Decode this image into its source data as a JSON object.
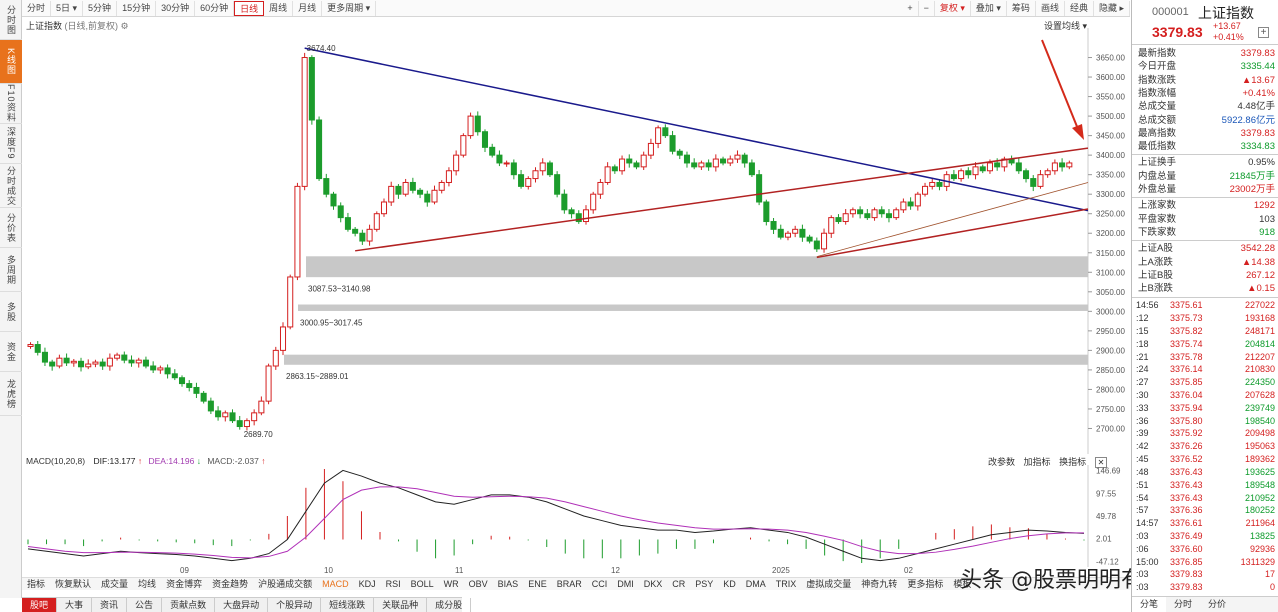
{
  "left_nav": [
    {
      "label": "分时图",
      "active": false
    },
    {
      "label": "K线图",
      "active": true
    },
    {
      "label": "F10资料",
      "active": false
    },
    {
      "label": "深度F9",
      "active": false
    },
    {
      "label": "分时成交",
      "active": false
    },
    {
      "label": "分价表",
      "active": false
    },
    {
      "label": "多周期",
      "active": false
    },
    {
      "label": "多股",
      "active": false
    },
    {
      "label": "资金",
      "active": false
    },
    {
      "label": "龙虎榜",
      "active": false
    }
  ],
  "toolbar": {
    "periods": [
      {
        "label": "分时",
        "active": false
      },
      {
        "label": "5日 ▾",
        "active": false
      },
      {
        "label": "5分钟",
        "active": false
      },
      {
        "label": "15分钟",
        "active": false
      },
      {
        "label": "30分钟",
        "active": false
      },
      {
        "label": "60分钟",
        "active": false
      },
      {
        "label": "日线",
        "active": true
      },
      {
        "label": "周线",
        "active": false
      },
      {
        "label": "月线",
        "active": false
      },
      {
        "label": "更多周期 ▾",
        "active": false
      }
    ],
    "right": [
      {
        "label": "+",
        "red": false
      },
      {
        "label": "−",
        "red": false
      },
      {
        "label": "复权 ▾",
        "red": true
      },
      {
        "label": "叠加 ▾",
        "red": false
      },
      {
        "label": "筹码",
        "red": false
      },
      {
        "label": "画线",
        "red": false
      },
      {
        "label": "经典",
        "red": false
      },
      {
        "label": "隐藏 ▸",
        "red": false
      }
    ]
  },
  "kline": {
    "title": "上证指数",
    "subtitle": "(日线,前复权)",
    "ma_setting": "设置均线 ▾",
    "annotations": {
      "high": "3674.40",
      "low": "2689.70",
      "gap1": "3087.53~3140.98",
      "gap2": "3000.95~3017.45",
      "gap3": "2863.15~2889.01"
    }
  },
  "macd": {
    "name": "MACD(10,20,8)",
    "dif": "DIF:13.177",
    "dea": "DEA:14.196",
    "macd": "MACD:-2.037",
    "tools": [
      "改参数",
      "加指标",
      "换指标"
    ],
    "axis": [
      "146.69",
      "97.55",
      "49.78",
      "2.01",
      "-47.12"
    ]
  },
  "date_axis": [
    "09",
    "10",
    "11",
    "12",
    "2025",
    "02"
  ],
  "indicator_tabs": [
    {
      "label": "指标",
      "active": false
    },
    {
      "label": "恢复默认",
      "active": false
    },
    {
      "label": "成交量",
      "active": false
    },
    {
      "label": "均线",
      "active": false
    },
    {
      "label": "资金博弈",
      "active": false
    },
    {
      "label": "资金趋势",
      "active": false
    },
    {
      "label": "沪股通成交额",
      "active": false
    },
    {
      "label": "MACD",
      "active": true
    },
    {
      "label": "KDJ",
      "active": false
    },
    {
      "label": "RSI",
      "active": false
    },
    {
      "label": "BOLL",
      "active": false
    },
    {
      "label": "WR",
      "active": false
    },
    {
      "label": "OBV",
      "active": false
    },
    {
      "label": "BIAS",
      "active": false
    },
    {
      "label": "ENE",
      "active": false
    },
    {
      "label": "BRAR",
      "active": false
    },
    {
      "label": "CCI",
      "active": false
    },
    {
      "label": "DMI",
      "active": false
    },
    {
      "label": "DKX",
      "active": false
    },
    {
      "label": "CR",
      "active": false
    },
    {
      "label": "PSY",
      "active": false
    },
    {
      "label": "KD",
      "active": false
    },
    {
      "label": "DMA",
      "active": false
    },
    {
      "label": "TRIX",
      "active": false
    },
    {
      "label": "虚拟成交量",
      "active": false
    },
    {
      "label": "神奇九转",
      "active": false
    },
    {
      "label": "更多指标",
      "active": false
    },
    {
      "label": "模板",
      "active": false
    }
  ],
  "bottom_tabs": [
    {
      "label": "股吧",
      "active": true
    },
    {
      "label": "大事",
      "active": false
    },
    {
      "label": "资讯",
      "active": false
    },
    {
      "label": "公告",
      "active": false
    },
    {
      "label": "贡献点数",
      "active": false
    },
    {
      "label": "大盘异动",
      "active": false
    },
    {
      "label": "个股异动",
      "active": false
    },
    {
      "label": "短线涨跌",
      "active": false
    },
    {
      "label": "关联品种",
      "active": false
    },
    {
      "label": "成分股",
      "active": false
    }
  ],
  "quote": {
    "code": "000001",
    "name": "上证指数",
    "price": "3379.83",
    "change": "+13.67",
    "change_pct": "+0.41%",
    "rows": [
      {
        "k": "最新指数",
        "v": "3379.83",
        "c": "red"
      },
      {
        "k": "今日开盘",
        "v": "3335.44",
        "c": "green"
      },
      {
        "k": "指数涨跌",
        "v": "▲13.67",
        "c": "red"
      },
      {
        "k": "指数涨幅",
        "v": "+0.41%",
        "c": "red"
      },
      {
        "k": "总成交量",
        "v": "4.48亿手",
        "c": "black"
      },
      {
        "k": "总成交额",
        "v": "5922.86亿元",
        "c": "blue"
      },
      {
        "k": "最高指数",
        "v": "3379.83",
        "c": "red"
      },
      {
        "k": "最低指数",
        "v": "3334.83",
        "c": "green"
      }
    ],
    "rows2": [
      {
        "k": "上证换手",
        "v": "0.95%",
        "c": "black"
      },
      {
        "k": "内盘总量",
        "v": "21845万手",
        "c": "green"
      },
      {
        "k": "外盘总量",
        "v": "23002万手",
        "c": "red"
      }
    ],
    "rows3": [
      {
        "k": "上涨家数",
        "v": "1292",
        "c": "red"
      },
      {
        "k": "平盘家数",
        "v": "103",
        "c": "black"
      },
      {
        "k": "下跌家数",
        "v": "918",
        "c": "green"
      }
    ],
    "rows4": [
      {
        "k": "上证A股",
        "v": "3542.28",
        "c": "red"
      },
      {
        "k": "上A涨跌",
        "v": "▲14.38",
        "c": "red"
      },
      {
        "k": "上证B股",
        "v": "267.12",
        "c": "red"
      },
      {
        "k": "上B涨跌",
        "v": "▲0.15",
        "c": "red"
      }
    ],
    "ticks": [
      {
        "t": "14:56",
        "p": "3375.61",
        "v": "227022",
        "c": "red"
      },
      {
        "t": ":12",
        "p": "3375.73",
        "v": "193168",
        "c": "red"
      },
      {
        "t": ":15",
        "p": "3375.82",
        "v": "248171",
        "c": "red"
      },
      {
        "t": ":18",
        "p": "3375.74",
        "v": "204814",
        "c": "green"
      },
      {
        "t": ":21",
        "p": "3375.78",
        "v": "212207",
        "c": "red"
      },
      {
        "t": ":24",
        "p": "3376.14",
        "v": "210830",
        "c": "red"
      },
      {
        "t": ":27",
        "p": "3375.85",
        "v": "224350",
        "c": "green"
      },
      {
        "t": ":30",
        "p": "3376.04",
        "v": "207628",
        "c": "red"
      },
      {
        "t": ":33",
        "p": "3375.94",
        "v": "239749",
        "c": "green"
      },
      {
        "t": ":36",
        "p": "3375.80",
        "v": "198540",
        "c": "green"
      },
      {
        "t": ":39",
        "p": "3375.92",
        "v": "209498",
        "c": "red"
      },
      {
        "t": ":42",
        "p": "3376.26",
        "v": "195063",
        "c": "red"
      },
      {
        "t": ":45",
        "p": "3376.52",
        "v": "189362",
        "c": "red"
      },
      {
        "t": ":48",
        "p": "3376.43",
        "v": "193625",
        "c": "green"
      },
      {
        "t": ":51",
        "p": "3376.43",
        "v": "189548",
        "c": "green"
      },
      {
        "t": ":54",
        "p": "3376.43",
        "v": "210952",
        "c": "green"
      },
      {
        "t": ":57",
        "p": "3376.36",
        "v": "180252",
        "c": "green"
      },
      {
        "t": "14:57",
        "p": "3376.61",
        "v": "211964",
        "c": "red"
      },
      {
        "t": ":03",
        "p": "3376.49",
        "v": "13825",
        "c": "green"
      },
      {
        "t": ":06",
        "p": "3376.60",
        "v": "92936",
        "c": "red"
      },
      {
        "t": "15:00",
        "p": "3376.85",
        "v": "1311329",
        "c": "red"
      },
      {
        "t": ":03",
        "p": "3379.83",
        "v": "17",
        "c": "red"
      },
      {
        "t": ":03",
        "p": "3379.83",
        "v": "0",
        "c": "red"
      }
    ],
    "tabs": [
      {
        "label": "分笔",
        "active": true
      },
      {
        "label": "分时",
        "active": false
      },
      {
        "label": "分价",
        "active": false
      }
    ]
  },
  "watermark": "头条 @股票明明有理",
  "chart_data": {
    "type": "candlestick",
    "title": "上证指数",
    "ylim": [
      2650,
      3700
    ],
    "y_ticks": [
      2700,
      2750,
      2800,
      2850,
      2900,
      2950,
      3000,
      3050,
      3100,
      3150,
      3200,
      3250,
      3300,
      3350,
      3400,
      3450,
      3500,
      3550,
      3600,
      3650
    ],
    "x_labels": [
      "09",
      "10",
      "11",
      "12",
      "2025",
      "02"
    ],
    "series": [
      {
        "name": "上证指数",
        "closes": [
          2915,
          2895,
          2870,
          2860,
          2880,
          2868,
          2872,
          2858,
          2865,
          2870,
          2860,
          2880,
          2888,
          2875,
          2868,
          2875,
          2860,
          2850,
          2855,
          2840,
          2830,
          2815,
          2805,
          2790,
          2770,
          2745,
          2730,
          2740,
          2720,
          2705,
          2720,
          2740,
          2770,
          2860,
          2900,
          2960,
          3088,
          3320,
          3650,
          3490,
          3340,
          3300,
          3270,
          3240,
          3210,
          3200,
          3180,
          3210,
          3250,
          3280,
          3320,
          3300,
          3330,
          3310,
          3300,
          3280,
          3310,
          3330,
          3360,
          3400,
          3450,
          3500,
          3460,
          3420,
          3400,
          3380,
          3380,
          3350,
          3320,
          3340,
          3360,
          3380,
          3350,
          3300,
          3260,
          3250,
          3230,
          3260,
          3300,
          3330,
          3370,
          3360,
          3390,
          3380,
          3370,
          3400,
          3430,
          3470,
          3450,
          3410,
          3400,
          3380,
          3370,
          3380,
          3370,
          3390,
          3380,
          3390,
          3400,
          3380,
          3350,
          3280,
          3230,
          3210,
          3190,
          3200,
          3210,
          3190,
          3180,
          3160,
          3200,
          3240,
          3230,
          3250,
          3260,
          3250,
          3240,
          3260,
          3250,
          3240,
          3260,
          3280,
          3270,
          3300,
          3320,
          3330,
          3320,
          3350,
          3340,
          3360,
          3350,
          3370,
          3360,
          3380,
          3370,
          3390,
          3380,
          3360,
          3340,
          3320,
          3350,
          3360,
          3380,
          3370,
          3380
        ]
      },
      {
        "name": "DIF",
        "values": [
          -20,
          -25,
          -30,
          -35,
          -30,
          -25,
          -28,
          -30,
          -32,
          -35,
          -40,
          -45,
          -40,
          -30,
          0,
          60,
          120,
          147,
          135,
          120,
          110,
          95,
          80,
          75,
          85,
          95,
          95,
          90,
          80,
          65,
          50,
          40,
          30,
          25,
          20,
          20,
          15,
          18,
          22,
          25,
          20,
          15,
          5,
          -10,
          -25,
          -40,
          -45,
          -40,
          -30,
          -20,
          -10,
          0,
          10,
          15,
          20,
          18,
          15,
          13
        ]
      },
      {
        "name": "DEA",
        "values": [
          -15,
          -20,
          -25,
          -28,
          -28,
          -27,
          -27,
          -28,
          -29,
          -31,
          -34,
          -38,
          -39,
          -36,
          -25,
          5,
          45,
          85,
          105,
          112,
          112,
          108,
          100,
          92,
          90,
          91,
          92,
          91,
          88,
          80,
          70,
          60,
          50,
          42,
          35,
          30,
          25,
          22,
          22,
          23,
          22,
          20,
          15,
          7,
          -2,
          -15,
          -25,
          -30,
          -30,
          -27,
          -21,
          -14,
          -6,
          2,
          8,
          12,
          14,
          14
        ]
      }
    ]
  }
}
